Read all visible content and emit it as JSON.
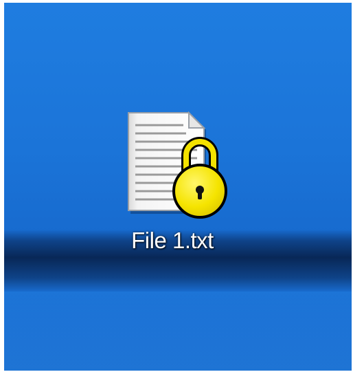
{
  "desktop": {
    "background_color": "#1b74d8",
    "icons": [
      {
        "label": "File 1.txt",
        "icon": "locked-text-file-icon",
        "lock_color": "#f7e600"
      }
    ]
  }
}
